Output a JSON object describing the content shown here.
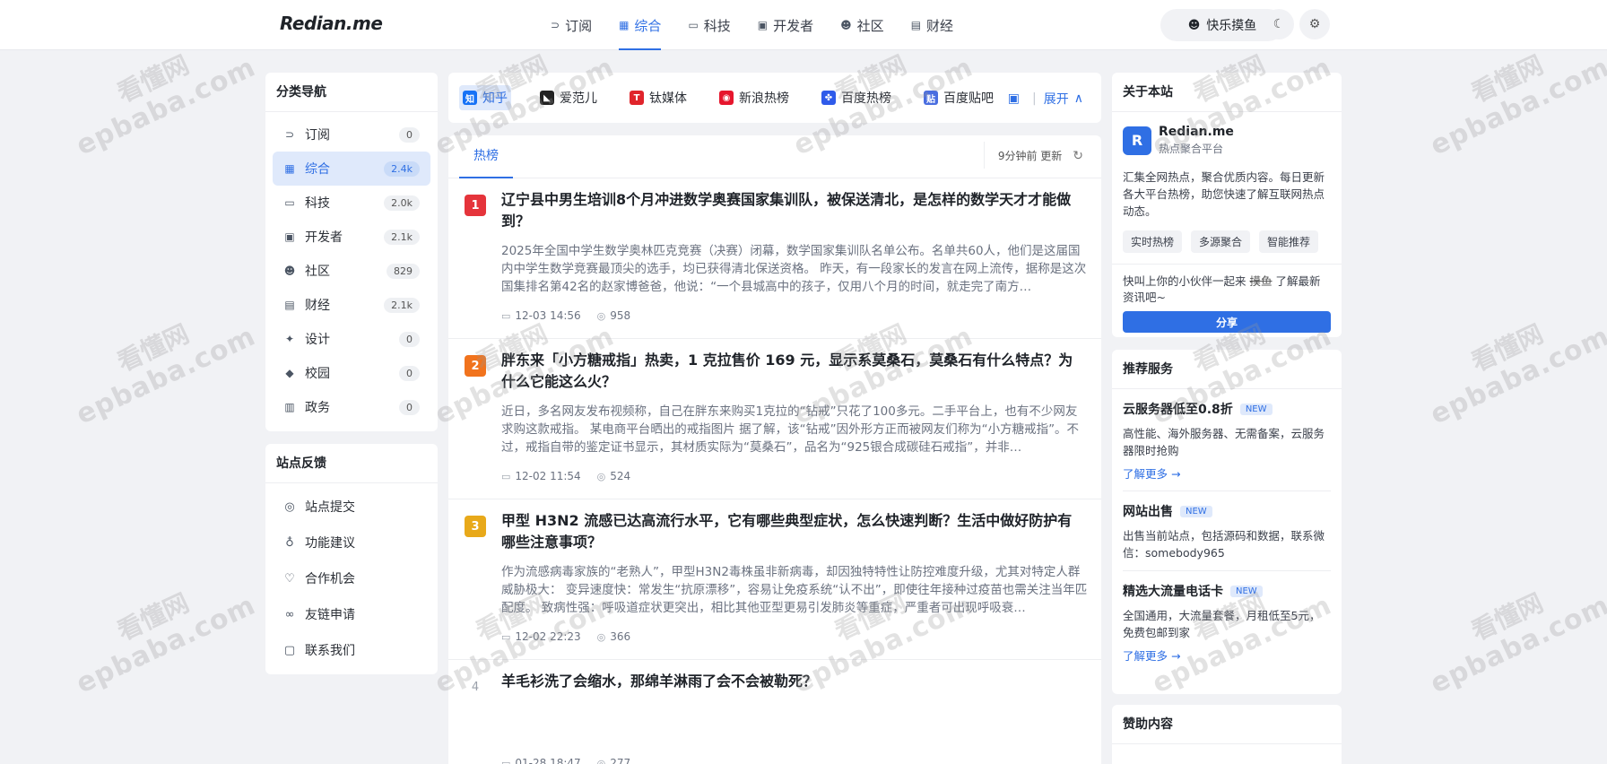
{
  "header": {
    "logo": "Redian.me",
    "nav": [
      {
        "label": "订阅",
        "icon": "rss-icon",
        "glyph": "⊃",
        "active": false
      },
      {
        "label": "综合",
        "icon": "grid-icon",
        "glyph": "▦",
        "active": true
      },
      {
        "label": "科技",
        "icon": "monitor-icon",
        "glyph": "▭",
        "active": false
      },
      {
        "label": "开发者",
        "icon": "terminal-icon",
        "glyph": "▣",
        "active": false
      },
      {
        "label": "社区",
        "icon": "users-icon",
        "glyph": "☻",
        "active": false
      },
      {
        "label": "财经",
        "icon": "money-icon",
        "glyph": "▤",
        "active": false
      }
    ],
    "mood_button": "快乐摸鱼",
    "mood_icon_glyph": "☻",
    "theme_glyph": "☾",
    "settings_glyph": "⚙"
  },
  "left": {
    "category_title": "分类导航",
    "categories": [
      {
        "label": "订阅",
        "count": "0",
        "glyph": "⊃"
      },
      {
        "label": "综合",
        "count": "2.4k",
        "glyph": "▦"
      },
      {
        "label": "科技",
        "count": "2.0k",
        "glyph": "▭"
      },
      {
        "label": "开发者",
        "count": "2.1k",
        "glyph": "▣"
      },
      {
        "label": "社区",
        "count": "829",
        "glyph": "☻"
      },
      {
        "label": "财经",
        "count": "2.1k",
        "glyph": "▤"
      },
      {
        "label": "设计",
        "count": "0",
        "glyph": "✦"
      },
      {
        "label": "校园",
        "count": "0",
        "glyph": "◆"
      },
      {
        "label": "政务",
        "count": "0",
        "glyph": "▥"
      }
    ],
    "feedback_title": "站点反馈",
    "feedback": [
      {
        "label": "站点提交",
        "glyph": "◎"
      },
      {
        "label": "功能建议",
        "glyph": "♁"
      },
      {
        "label": "合作机会",
        "glyph": "♡"
      },
      {
        "label": "友链申请",
        "glyph": "∞"
      },
      {
        "label": "联系我们",
        "glyph": "▢"
      }
    ]
  },
  "sources": {
    "items": [
      {
        "label": "知乎",
        "icon_text": "知",
        "color": "#1772f6",
        "active": true
      },
      {
        "label": "爱范儿",
        "icon_text": "◣",
        "color": "#222222",
        "active": false
      },
      {
        "label": "钛媒体",
        "icon_text": "T",
        "color": "#e0242b",
        "active": false
      },
      {
        "label": "新浪热榜",
        "icon_text": "◉",
        "color": "#e6162d",
        "active": false
      },
      {
        "label": "百度热榜",
        "icon_text": "✤",
        "color": "#2f5bea",
        "active": false
      },
      {
        "label": "百度贴吧",
        "icon_text": "贴",
        "color": "#4a6ee0",
        "active": false
      }
    ],
    "expand_label": "展开",
    "expand_glyph": "▣",
    "chevron_glyph": "∧"
  },
  "feed": {
    "tab": "热榜",
    "updated": "9分钟前 更新",
    "refresh_glyph": "↻",
    "items": [
      {
        "rank": "1",
        "rank_color": "#e5343b",
        "title": "辽宁县中男生培训8个月冲进数学奥赛国家集训队，被保送清北，是怎样的数学天才才能做到？",
        "desc": "2025年全国中学生数学奥林匹克竞赛（决赛）闭幕，数学国家集训队名单公布。名单共60人，他们是这届国内中学生数学竞赛最顶尖的选手，均已获得清北保送资格。 昨天，有一段家长的发言在网上流传，据称是这次国集排名第42名的赵家博爸爸，他说：“一个县城高中的孩子，仅用八个月的时间，就走完了南方…",
        "time": "12-03 14:56",
        "hot": "958"
      },
      {
        "rank": "2",
        "rank_color": "#f1731d",
        "title": "胖东来「小方糖戒指」热卖，1 克拉售价 169 元，显示系莫桑石，莫桑石有什么特点？为什么它能这么火？",
        "desc": "近日，多名网友发布视频称，自己在胖东来购买1克拉的“钻戒”只花了100多元。二手平台上，也有不少网友求购这款戒指。 某电商平台晒出的戒指图片 据了解，该“钻戒”因外形方正而被网友们称为“小方糖戒指”。不过，戒指自带的鉴定证书显示，其材质实际为“莫桑石”，品名为“925银合成碳硅石戒指”，并非…",
        "time": "12-02 11:54",
        "hot": "524"
      },
      {
        "rank": "3",
        "rank_color": "#e8a91a",
        "title": "甲型 H3N2 流感已达高流行水平，它有哪些典型症状，怎么快速判断？生活中做好防护有哪些注意事项？",
        "desc": "作为流感病毒家族的“老熟人”，甲型H3N2毒株虽非新病毒，却因独特特性让防控难度升级，尤其对特定人群威胁极大： 变异速度快：常发生“抗原漂移”，容易让免疫系统“认不出”，即使往年接种过疫苗也需关注当年匹配度。 致病性强：呼吸道症状更突出，相比其他亚型更易引发肺炎等重症，严重者可出现呼吸衰…",
        "time": "12-02 22:23",
        "hot": "366"
      },
      {
        "rank": "4",
        "rank_color": "",
        "title": "羊毛衫洗了会缩水，那绵羊淋雨了会不会被勒死？",
        "desc": "",
        "time": "01-28 18:47",
        "hot": "277"
      }
    ]
  },
  "right": {
    "about_title": "关于本站",
    "brand_letter": "R",
    "brand_name": "Redian.me",
    "brand_sub": "热点聚合平台",
    "about_desc": "汇集全网热点，聚合优质内容。每日更新各大平台热榜，助您快速了解互联网热点动态。",
    "tags": [
      "实时热榜",
      "多源聚合",
      "智能推荐"
    ],
    "share_text_pre": "快叫上你的小伙伴一起来 ",
    "share_text_strike": "摸鱼",
    "share_text_post": " 了解最新资讯吧~",
    "share_button": "分享",
    "services_title": "推荐服务",
    "services": [
      {
        "title": "云服务器低至0.8折",
        "badge": "NEW",
        "desc": "高性能、海外服务器、无需备案，云服务器限时抢购",
        "link": "了解更多 →"
      },
      {
        "title": "网站出售",
        "badge": "NEW",
        "desc": "出售当前站点，包括源码和数据，联系微信：somebody965",
        "link": ""
      },
      {
        "title": "精选大流量电话卡",
        "badge": "NEW",
        "desc": "全国通用，大流量套餐，月租低至5元，免费包邮到家",
        "link": "了解更多 →"
      }
    ],
    "sponsor_title": "赞助内容"
  },
  "watermark": {
    "line1": "看懂网",
    "line2": "epbaba.com"
  },
  "colors": {
    "accent": "#2f6fe4",
    "rank1": "#e5343b",
    "rank2": "#f1731d",
    "rank3": "#e8a91a"
  }
}
